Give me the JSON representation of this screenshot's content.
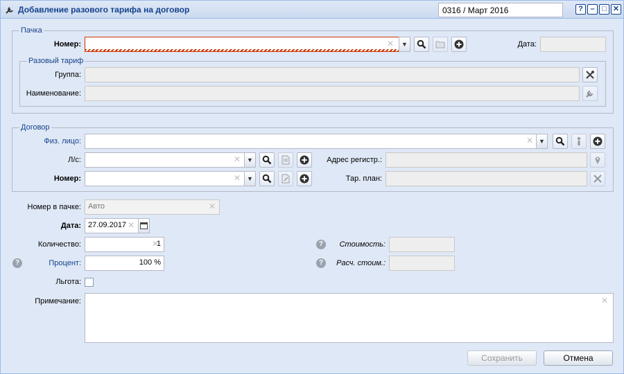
{
  "window": {
    "title": "Добавление разового тарифа на договор",
    "period": "0316 / Март 2016",
    "tools": [
      "?",
      "–",
      "□",
      "✕"
    ]
  },
  "pachka": {
    "legend": "Пачка",
    "nomer_label": "Номер:",
    "nomer_value": "",
    "data_label": "Дата:",
    "data_value": "",
    "tariff": {
      "legend": "Разовый тариф",
      "gruppa_label": "Группа:",
      "gruppa_value": "",
      "naim_label": "Наименование:",
      "naim_value": ""
    }
  },
  "dogovor": {
    "legend": "Договор",
    "fiz_label": "Физ. лицо:",
    "fiz_value": "",
    "ls_label": "Л/с:",
    "ls_value": "",
    "nomer_label": "Номер:",
    "nomer_value": "",
    "adres_label": "Адрес регистр.:",
    "adres_value": "",
    "tarplan_label": "Тар. план:",
    "tarplan_value": ""
  },
  "form": {
    "nomer_v_pachke_label": "Номер в пачке:",
    "nomer_v_pachke_placeholder": "Авто",
    "data_label": "Дата:",
    "data_value": "27.09.2017",
    "kolichestvo_label": "Количество:",
    "kolichestvo_value": "1",
    "procent_label": "Процент:",
    "procent_value": "100 %",
    "lgota_label": "Льгота:",
    "stoimost_label": "Стоимость:",
    "stoimost_value": "",
    "rasch_label": "Расч. стоим.:",
    "rasch_value": "",
    "primechanie_label": "Примечание:",
    "primechanie_value": ""
  },
  "buttons": {
    "save": "Сохранить",
    "cancel": "Отмена"
  },
  "colors": {
    "accent": "#15428b",
    "window_bg": "#dfe8f6",
    "error": "#cc3300"
  }
}
